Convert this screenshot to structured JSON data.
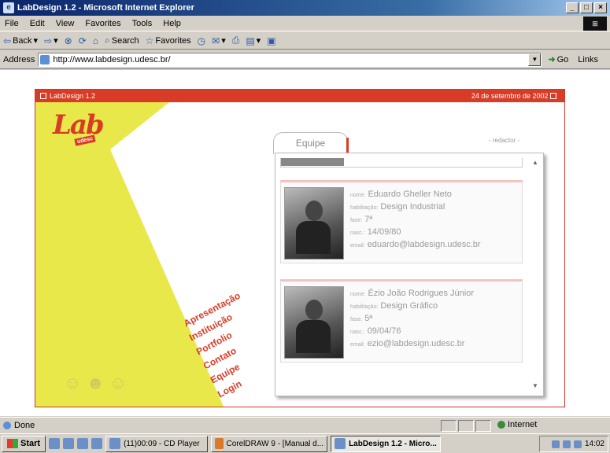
{
  "window": {
    "title": "LabDesign 1.2 - Microsoft Internet Explorer",
    "buttons": [
      "_",
      "□",
      "×"
    ]
  },
  "menu": [
    "File",
    "Edit",
    "View",
    "Favorites",
    "Tools",
    "Help"
  ],
  "toolbar": {
    "back": "Back",
    "search": "Search",
    "favorites": "Favorites"
  },
  "address": {
    "label": "Address",
    "url": "http://www.labdesign.udesc.br/",
    "go": "Go",
    "links": "Links"
  },
  "site": {
    "header_title": "LabDesign 1.2",
    "header_date": "24 de setembro de 2002",
    "logo_text": "Lab",
    "logo_tag": "udesc",
    "nav": [
      "Apresentação",
      "Instituição",
      "Portfolio",
      "Contato",
      "Equipe",
      "Login"
    ],
    "tab": "Equipe",
    "redator": "- redactor -",
    "members": [
      {
        "labels": {
          "nome": "nome:",
          "habilitacao": "habilitação:",
          "fase": "fase:",
          "nasc": "nasc.:",
          "email": "email:"
        },
        "nome": "Eduardo Gheller Neto",
        "habilitacao": "Design Industrial",
        "fase": "7ª",
        "nasc": "14/09/80",
        "email": "eduardo@labdesign.udesc.br"
      },
      {
        "labels": {
          "nome": "nome:",
          "habilitacao": "habilitação:",
          "fase": "fase:",
          "nasc": "nasc.:",
          "email": "email:"
        },
        "nome": "Ézio João Rodrigues Júnior",
        "habilitacao": "Design Gráfico",
        "fase": "5ª",
        "nasc": "09/04/76",
        "email": "ezio@labdesign.udesc.br"
      }
    ]
  },
  "status": {
    "text": "Done",
    "zone": "Internet"
  },
  "taskbar": {
    "start": "Start",
    "tasks": [
      "(11)00:09 - CD Player",
      "CorelDRAW 9 - [Manual d...",
      "LabDesign 1.2 - Micro..."
    ],
    "clock": "14:02"
  },
  "colors": {
    "brand_red": "#d83c26",
    "yellow": "#e9e84a",
    "titlebar": "#0a246a"
  }
}
